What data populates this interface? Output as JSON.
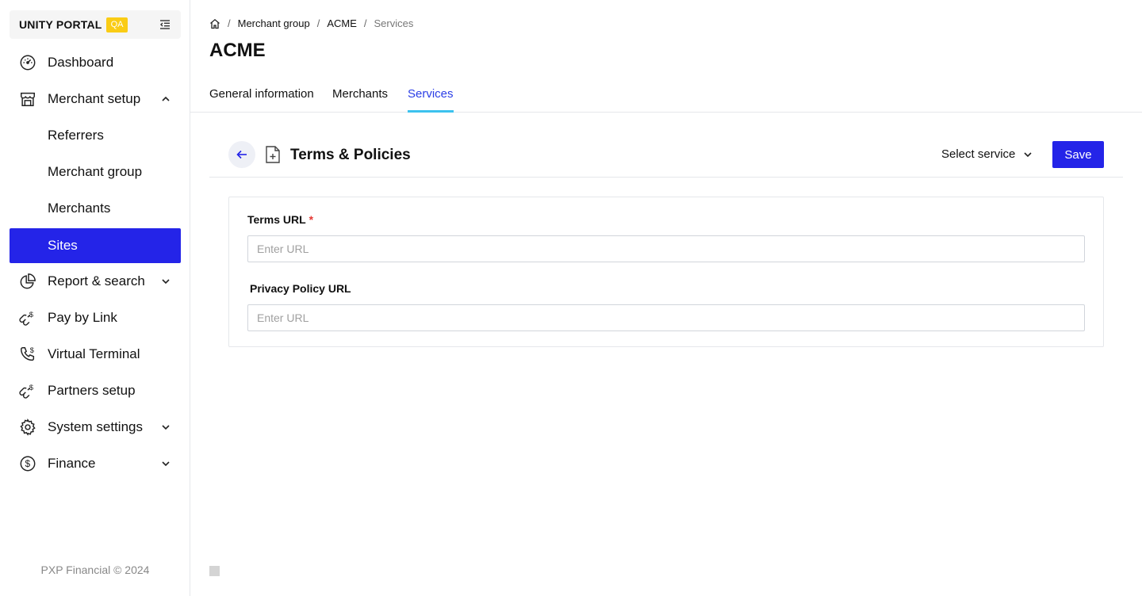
{
  "brand": {
    "name": "UNITY PORTAL",
    "badge": "QA",
    "badge_color": "#facc15"
  },
  "sidebar": {
    "items": [
      {
        "label": "Dashboard",
        "icon": "dashboard-gauge-icon"
      },
      {
        "label": "Merchant setup",
        "icon": "storefront-icon",
        "expanded": true
      },
      {
        "label": "Referrers"
      },
      {
        "label": "Merchant group"
      },
      {
        "label": "Merchants"
      },
      {
        "label": "Sites",
        "active": true
      },
      {
        "label": "Report & search",
        "icon": "pie-chart-icon",
        "expanded": false
      },
      {
        "label": "Pay by Link",
        "icon": "link-dollar-icon"
      },
      {
        "label": "Virtual Terminal",
        "icon": "phone-dollar-icon"
      },
      {
        "label": "Partners setup",
        "icon": "link-dollar-icon"
      },
      {
        "label": "System settings",
        "icon": "gear-icon",
        "expanded": false
      },
      {
        "label": "Finance",
        "icon": "dollar-circle-icon",
        "expanded": false
      }
    ],
    "footer": "PXP Financial © 2024"
  },
  "breadcrumb": {
    "home_icon": "home-icon",
    "items": [
      "Merchant group",
      "ACME",
      "Services"
    ]
  },
  "page": {
    "title": "ACME"
  },
  "tabs": [
    {
      "label": "General information"
    },
    {
      "label": "Merchants"
    },
    {
      "label": "Services",
      "active": true
    }
  ],
  "section": {
    "title": "Terms & Policies",
    "select_service": "Select service",
    "save_label": "Save"
  },
  "form": {
    "terms_label": "Terms URL",
    "terms_required": "*",
    "terms_value": "",
    "terms_placeholder": "Enter URL",
    "privacy_label": "Privacy Policy URL",
    "privacy_value": "",
    "privacy_placeholder": "Enter URL"
  },
  "colors": {
    "accent": "#2424e8",
    "tab_active_text": "#2b3ee6",
    "tab_underline": "#3cc2ee",
    "required": "#e53935"
  }
}
